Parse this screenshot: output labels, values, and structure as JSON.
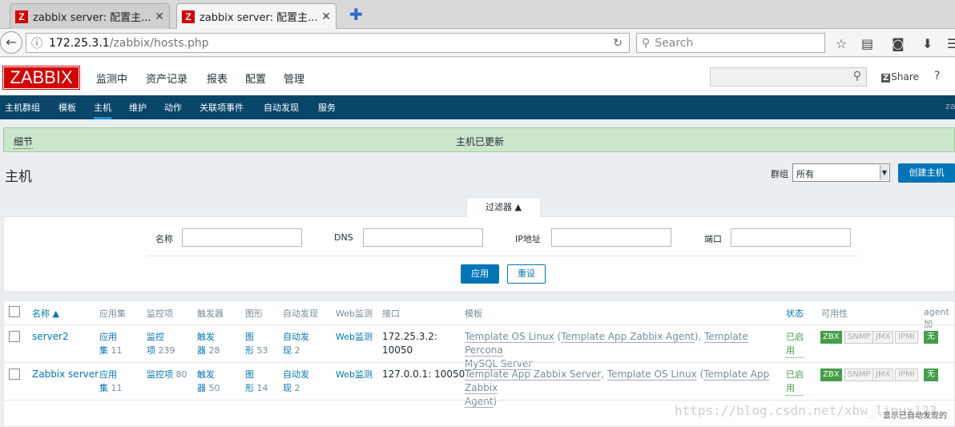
{
  "browser": {
    "tabs": [
      {
        "title": "zabbix server: 配置主...",
        "close": "✕"
      },
      {
        "title": "zabbix server: 配置主...",
        "close": "✕"
      }
    ],
    "new_tab": "✚",
    "url_domain": "172.25.3.1",
    "url_path": "/zabbix/hosts.php",
    "search_placeholder": "Search"
  },
  "header": {
    "logo": "ZABBIX",
    "menu": [
      "监测中",
      "资产记录",
      "报表",
      "配置",
      "管理"
    ],
    "share": "Share",
    "help": "?"
  },
  "submenu": {
    "items": [
      "主机群组",
      "模板",
      "主机",
      "维护",
      "动作",
      "关联项事件",
      "自动发现",
      "服务"
    ],
    "selected": "主机",
    "right_text": "za"
  },
  "message": {
    "details": "细节",
    "text": "主机已更新"
  },
  "page": {
    "title": "主机",
    "group_label": "群组",
    "group_value": "所有",
    "create_button": "创建主机"
  },
  "filter": {
    "tab_label": "过滤器 ▲",
    "fields": [
      {
        "label": "名称",
        "value": ""
      },
      {
        "label": "DNS",
        "value": ""
      },
      {
        "label": "IP地址",
        "value": ""
      },
      {
        "label": "端口",
        "value": ""
      }
    ],
    "apply": "应用",
    "reset": "重设"
  },
  "table": {
    "headers": {
      "name": "名称 ▲",
      "apps": "应用集",
      "items": "监控项",
      "triggers": "触发器",
      "graphs": "图形",
      "discovery": "自动发现",
      "web": "Web监测",
      "interface": "接口",
      "templates": "模板",
      "status": "状态",
      "availability": "可用性",
      "agent": "agent 加"
    },
    "rows": [
      {
        "name": "server2",
        "apps_label_1": "应用",
        "apps_label_2": "集",
        "apps_count": "11",
        "items_label_1": "监控",
        "items_label_2": "项",
        "items_count": "239",
        "triggers_label_1": "触发",
        "triggers_label_2": "器",
        "triggers_count": "28",
        "graphs_label_1": "图",
        "graphs_label_2": "形",
        "graphs_count": "53",
        "disc_label_1": "自动发",
        "disc_label_2": "现",
        "disc_count": "2",
        "web": "Web监测",
        "interface_1": "172.25.3.2:",
        "interface_2": "10050",
        "template_1": "Template OS Linux",
        "template_2": "Template App Zabbix Agent",
        "template_3": "Template Percona",
        "template_4": "MySQL Server",
        "status_1": "已启",
        "status_2": "用",
        "zbx": "ZBX",
        "snmp": "SNMP",
        "jmx": "JMX",
        "ipmi": "IPMI",
        "agent": "无"
      },
      {
        "name": "Zabbix server",
        "apps_label_1": "应用",
        "apps_label_2": "集",
        "apps_count": "11",
        "items_label": "监控项",
        "items_count": "80",
        "triggers_label_1": "触发",
        "triggers_label_2": "器",
        "triggers_count": "50",
        "graphs_label_1": "图",
        "graphs_label_2": "形",
        "graphs_count": "14",
        "disc_label_1": "自动发",
        "disc_label_2": "现",
        "disc_count": "2",
        "web": "Web监测",
        "interface": "127.0.0.1: 10050",
        "template_1": "Template App Zabbix Server",
        "template_2": "Template OS Linux",
        "template_3": "Template App Zabbix",
        "template_4": "Agent",
        "status_1": "已启",
        "status_2": "用",
        "zbx": "ZBX",
        "snmp": "SNMP",
        "jmx": "JMX",
        "ipmi": "IPMI",
        "agent": "无"
      }
    ]
  },
  "watermark": "https://blog.csdn.net/xbw_linux123",
  "footnote": "显示已自动发现的"
}
